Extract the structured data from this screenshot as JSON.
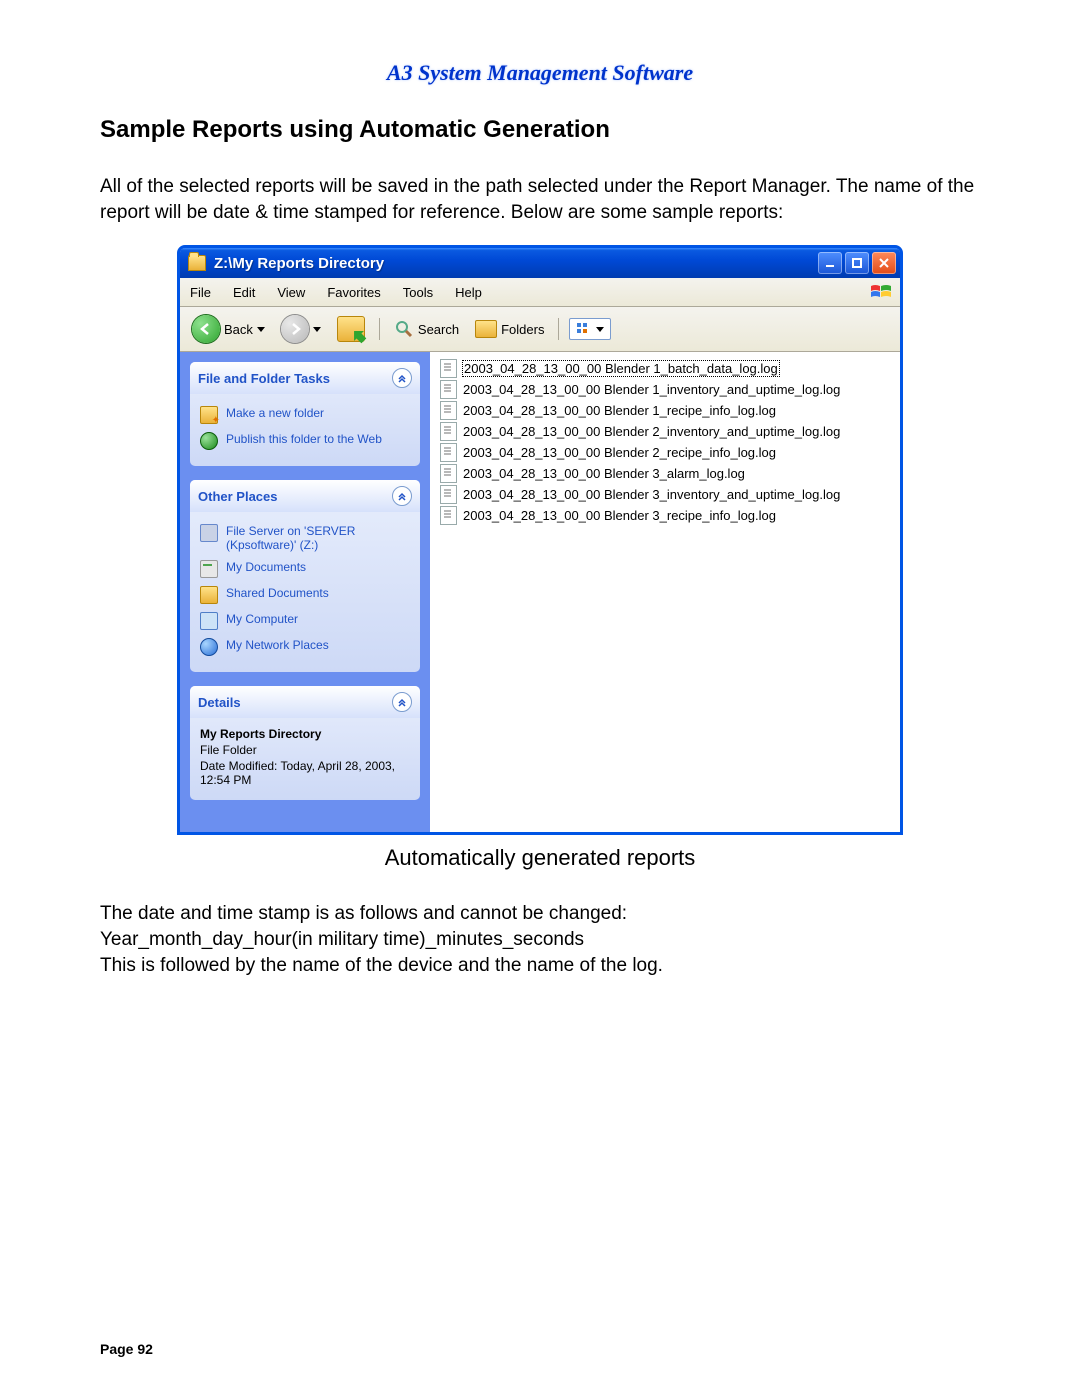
{
  "doc": {
    "header": "A3 System Management Software",
    "section_title": "Sample Reports using Automatic Generation",
    "intro": "All of the selected reports will be saved in the path selected under the Report Manager. The name of the report will be date & time stamped for reference.  Below are some sample reports:",
    "caption": "Automatically generated reports",
    "footer1": "The date and time stamp is as follows and cannot be changed:",
    "footer2": "Year_month_day_hour(in military time)_minutes_seconds",
    "footer3": "This is followed by the name of the device and the name of the log.",
    "page_label": "Page 92"
  },
  "window": {
    "title": "Z:\\My Reports Directory",
    "menu": {
      "file": "File",
      "edit": "Edit",
      "view": "View",
      "favorites": "Favorites",
      "tools": "Tools",
      "help": "Help"
    },
    "toolbar": {
      "back": "Back",
      "search": "Search",
      "folders": "Folders"
    }
  },
  "sidepane": {
    "tasks": {
      "title": "File and Folder Tasks",
      "items": [
        "Make a new folder",
        "Publish this folder to the Web"
      ]
    },
    "places": {
      "title": "Other Places",
      "items": [
        "File Server on 'SERVER (Kpsoftware)' (Z:)",
        "My Documents",
        "Shared Documents",
        "My Computer",
        "My Network Places"
      ]
    },
    "details": {
      "title": "Details",
      "name": "My Reports Directory",
      "type": "File Folder",
      "modified": "Date Modified: Today, April 28, 2003, 12:54 PM"
    }
  },
  "files": [
    "2003_04_28_13_00_00 Blender 1_batch_data_log.log",
    "2003_04_28_13_00_00 Blender 1_inventory_and_uptime_log.log",
    "2003_04_28_13_00_00 Blender 1_recipe_info_log.log",
    "2003_04_28_13_00_00 Blender 2_inventory_and_uptime_log.log",
    "2003_04_28_13_00_00 Blender 2_recipe_info_log.log",
    "2003_04_28_13_00_00 Blender 3_alarm_log.log",
    "2003_04_28_13_00_00 Blender 3_inventory_and_uptime_log.log",
    "2003_04_28_13_00_00 Blender 3_recipe_info_log.log"
  ]
}
